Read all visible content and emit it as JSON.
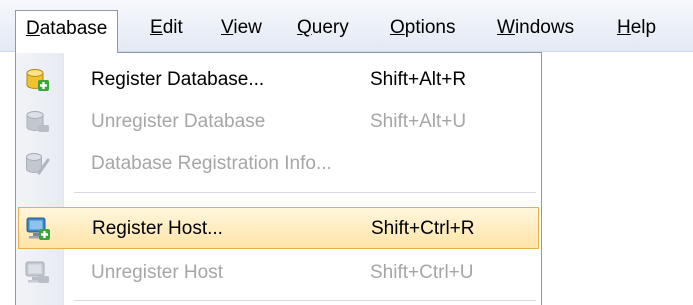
{
  "menubar": {
    "items": [
      {
        "label": "Database",
        "accel": "D",
        "rest": "atabase",
        "open": true
      },
      {
        "label": "Edit",
        "accel": "E",
        "rest": "dit"
      },
      {
        "label": "View",
        "accel": "V",
        "rest": "iew"
      },
      {
        "label": "Query",
        "accel": "Q",
        "rest": "uery"
      },
      {
        "label": "Options",
        "accel": "O",
        "rest": "ptions"
      },
      {
        "label": "Windows",
        "accel": "W",
        "rest": "indows"
      },
      {
        "label": "Help",
        "accel": "H",
        "rest": "elp"
      }
    ]
  },
  "dropdown": {
    "items": [
      {
        "label": "Register Database...",
        "shortcut": "Shift+Alt+R",
        "enabled": true,
        "icon": "register-database-icon"
      },
      {
        "label": "Unregister Database",
        "shortcut": "Shift+Alt+U",
        "enabled": false,
        "icon": "unregister-database-icon"
      },
      {
        "label": "Database Registration Info...",
        "shortcut": "",
        "enabled": false,
        "icon": "database-info-icon"
      },
      {
        "label": "Register Host...",
        "shortcut": "Shift+Ctrl+R",
        "enabled": true,
        "highlighted": true,
        "icon": "register-host-icon"
      },
      {
        "label": "Unregister Host",
        "shortcut": "Shift+Ctrl+U",
        "enabled": false,
        "icon": "unregister-host-icon"
      }
    ]
  },
  "colors": {
    "highlight_border": "#e7b24c",
    "highlight_fill": "#ffe4a8",
    "disabled_text": "#a6a6a6",
    "database_icon": "#f2c12e",
    "host_icon": "#3f86c4",
    "plus_icon": "#3aa53a"
  }
}
